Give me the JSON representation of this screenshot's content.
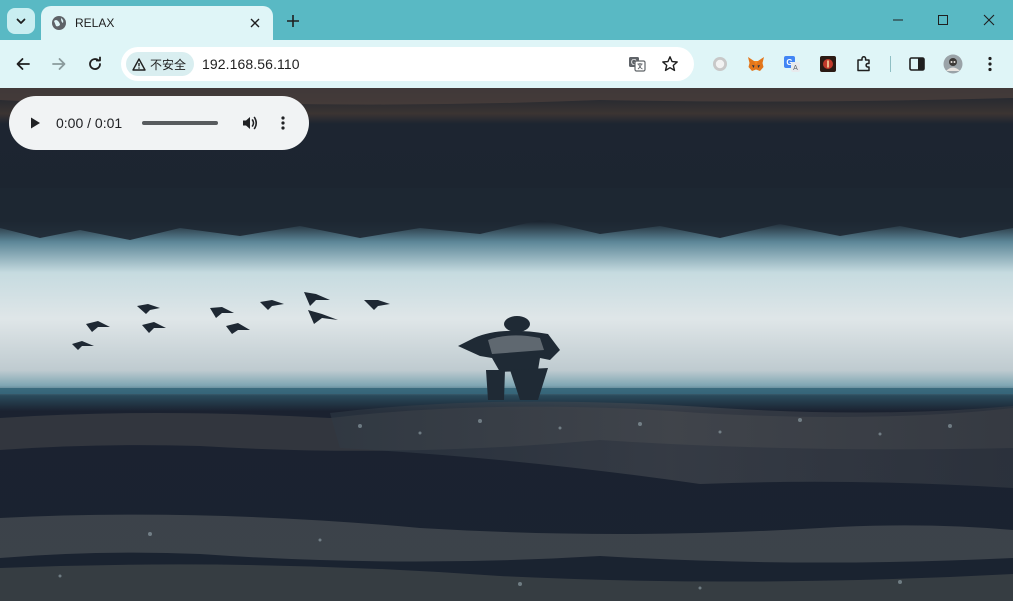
{
  "browser": {
    "tab_title": "RELAX",
    "security_label": "不安全",
    "url": "192.168.56.110"
  },
  "icons": {
    "tab_search": "chevron-down-icon",
    "favicon": "globe-icon",
    "tab_close": "close-icon",
    "new_tab": "plus-icon",
    "minimize": "minimize-icon",
    "maximize": "maximize-icon",
    "close_window": "close-icon",
    "back": "arrow-left-icon",
    "forward": "arrow-right-icon",
    "reload": "reload-icon",
    "warning": "warning-triangle-icon",
    "translate": "translate-icon",
    "bookmark": "star-icon",
    "extensions": [
      "circle-extension-icon",
      "metamask-fox-icon",
      "google-translate-extension-icon",
      "red-extension-icon",
      "puzzle-icon"
    ],
    "side_panel": "side-panel-icon",
    "profile": "avatar",
    "menu": "kebab-menu-icon"
  },
  "audio": {
    "time": "0:00 / 0:01",
    "progress": 0
  },
  "colors": {
    "tabstrip": "#59b9c4",
    "toolbar": "#dff5f7",
    "audio_bg": "#f1f3f4"
  }
}
